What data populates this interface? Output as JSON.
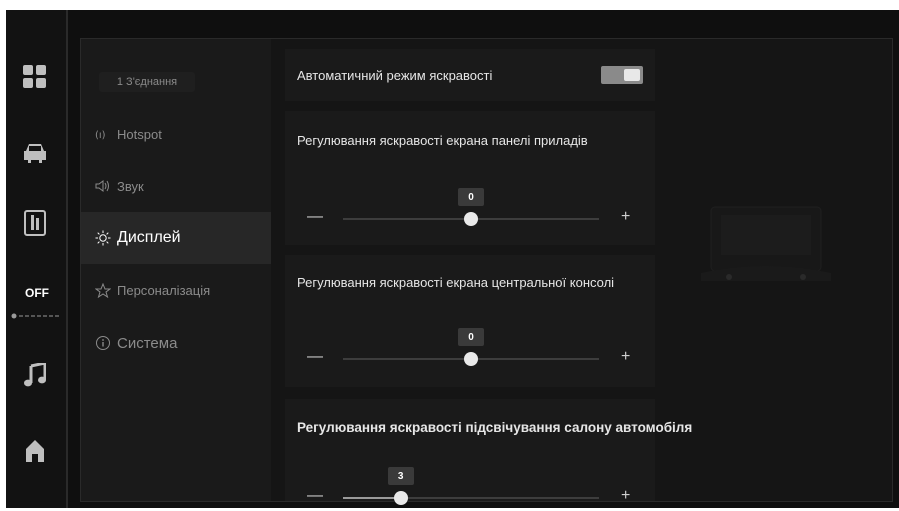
{
  "dock": {
    "fan_status": "OFF",
    "icons": [
      "grid-apps-icon",
      "car-icon",
      "phone-tablet-icon",
      "fan-icon",
      "music-note-icon",
      "home-icon"
    ]
  },
  "menu": {
    "connections_label": "1 З'єднання",
    "items": [
      {
        "icon": "hotspot-icon",
        "label": "Hotspot"
      },
      {
        "icon": "speaker-icon",
        "label": "Звук"
      },
      {
        "icon": "sun-icon",
        "label": "Дисплей",
        "active": true
      },
      {
        "icon": "star-outline-icon",
        "label": "Персоналізація"
      },
      {
        "icon": "info-icon",
        "label": "Система"
      }
    ]
  },
  "display": {
    "auto_brightness": {
      "label": "Автоматичний режим яскравості",
      "on": true
    },
    "dashboard": {
      "label": "Регулювання яскравості екрана панелі приладів",
      "value": 0,
      "value_text": "0",
      "min": 0,
      "max": 10
    },
    "console": {
      "label": "Регулювання яскравості екрана центральної консолі",
      "value": 0,
      "value_text": "0",
      "min": 0,
      "max": 10
    },
    "cabin": {
      "label": "Регулювання яскравості підсвічування салону автомобіля",
      "value": 3,
      "value_text": "3",
      "min": 0,
      "max": 10
    },
    "minus_symbol": "—",
    "plus_symbol": "+"
  },
  "colors": {
    "background": "#0f0f0f",
    "panel": "#1a1a1a",
    "active_menu": "#272727",
    "text": "#e6e6e6",
    "muted_text": "#8b8b8b"
  }
}
